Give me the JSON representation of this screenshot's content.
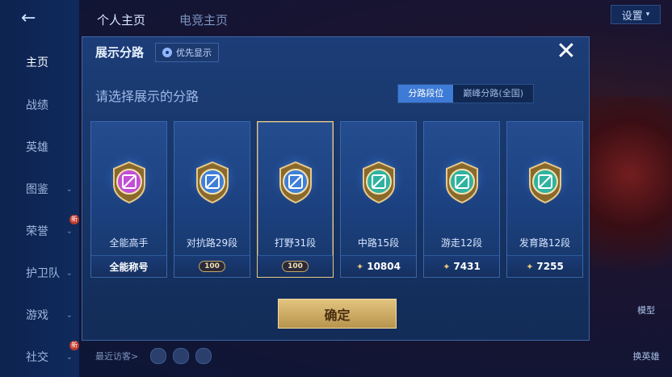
{
  "nav": {
    "back_icon": "back-arrow-icon",
    "items": [
      {
        "label": "主页",
        "active": true,
        "chevron": false,
        "new": false
      },
      {
        "label": "战绩",
        "active": false,
        "chevron": false,
        "new": false
      },
      {
        "label": "英雄",
        "active": false,
        "chevron": false,
        "new": false
      },
      {
        "label": "图鉴",
        "active": false,
        "chevron": true,
        "new": false
      },
      {
        "label": "荣誉",
        "active": false,
        "chevron": true,
        "new": true
      },
      {
        "label": "护卫队",
        "active": false,
        "chevron": true,
        "new": false
      },
      {
        "label": "游戏",
        "active": false,
        "chevron": true,
        "new": false
      },
      {
        "label": "社交",
        "active": false,
        "chevron": true,
        "new": true
      }
    ],
    "new_badge": "新"
  },
  "header": {
    "tab_profile": "个人主页",
    "tab_esports": "电竞主页",
    "settings": "设置"
  },
  "bottom": {
    "recent_visitors": "最近访客>",
    "model": "模型",
    "switch_hero": "换英雄"
  },
  "modal": {
    "title": "展示分路",
    "priority_label": "优先显示",
    "close_icon": "close-icon",
    "prompt": "请选择展示的分路",
    "toggle": {
      "rank": "分路段位",
      "peak": "巅峰分路(全国)",
      "active": "rank"
    },
    "cards": [
      {
        "label": "全能高手",
        "footer": "全能称号",
        "footer_type": "text",
        "color": "#c24fd6",
        "selected": false
      },
      {
        "label": "对抗路29段",
        "footer": "100",
        "footer_type": "hundred",
        "color": "#3f7fd8",
        "selected": false
      },
      {
        "label": "打野31段",
        "footer": "100",
        "footer_type": "hundred",
        "color": "#3f7fd8",
        "selected": true
      },
      {
        "label": "中路15段",
        "footer": "10804",
        "footer_type": "points",
        "color": "#2fb3a0",
        "selected": false
      },
      {
        "label": "游走12段",
        "footer": "7431",
        "footer_type": "points",
        "color": "#2fb3a0",
        "selected": false
      },
      {
        "label": "发育路12段",
        "footer": "7255",
        "footer_type": "points",
        "color": "#2fb3a0",
        "selected": false
      }
    ],
    "confirm": "确定"
  },
  "colors": {
    "accent": "#3d7bd6",
    "gold": "#e2c47f"
  }
}
